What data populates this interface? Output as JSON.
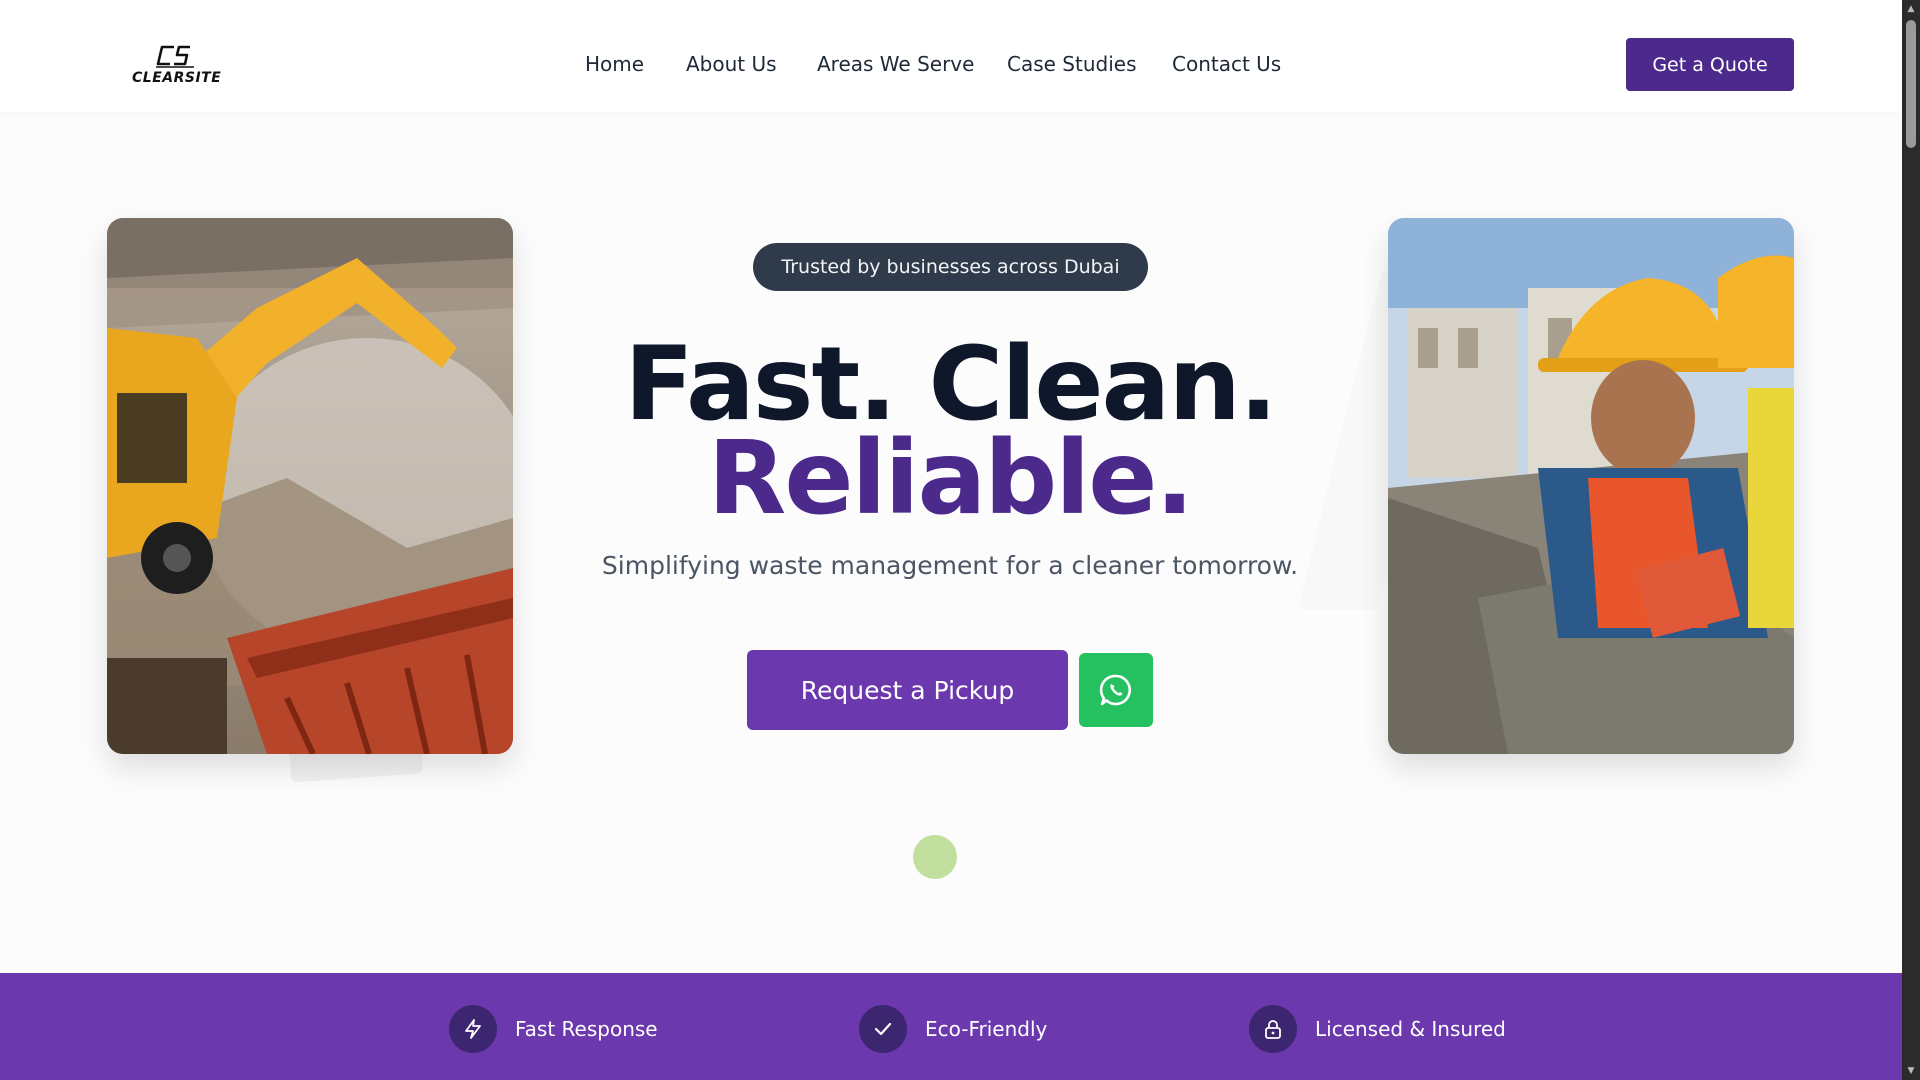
{
  "brand": {
    "logo_text": "CLEARSITE",
    "logo_icon": "cs-monogram-icon"
  },
  "nav": {
    "items": [
      {
        "label": "Home"
      },
      {
        "label": "About Us"
      },
      {
        "label": "Areas We Serve"
      },
      {
        "label": "Case Studies"
      },
      {
        "label": "Contact Us"
      }
    ],
    "cta": "Get a Quote"
  },
  "hero": {
    "badge": "Trusted by businesses across Dubai",
    "headline_1": "Fast. Clean.",
    "headline_2": "Reliable.",
    "subtitle": "Simplifying waste management for a cleaner tomorrow.",
    "primary_cta": "Request a Pickup",
    "secondary_icon": "whatsapp-icon",
    "left_image": "excavator-demolition-image",
    "right_image": "construction-workers-image"
  },
  "features": [
    {
      "label": "Fast Response",
      "icon": "lightning-icon"
    },
    {
      "label": "Eco-Friendly",
      "icon": "check-icon"
    },
    {
      "label": "Licensed & Insured",
      "icon": "lock-icon"
    }
  ],
  "colors": {
    "primary": "#6b38ad",
    "primary_dark": "#4b2a8c",
    "badge_bg": "#2f3a4b",
    "whatsapp": "#25c05f",
    "headline": "#0f172a"
  }
}
